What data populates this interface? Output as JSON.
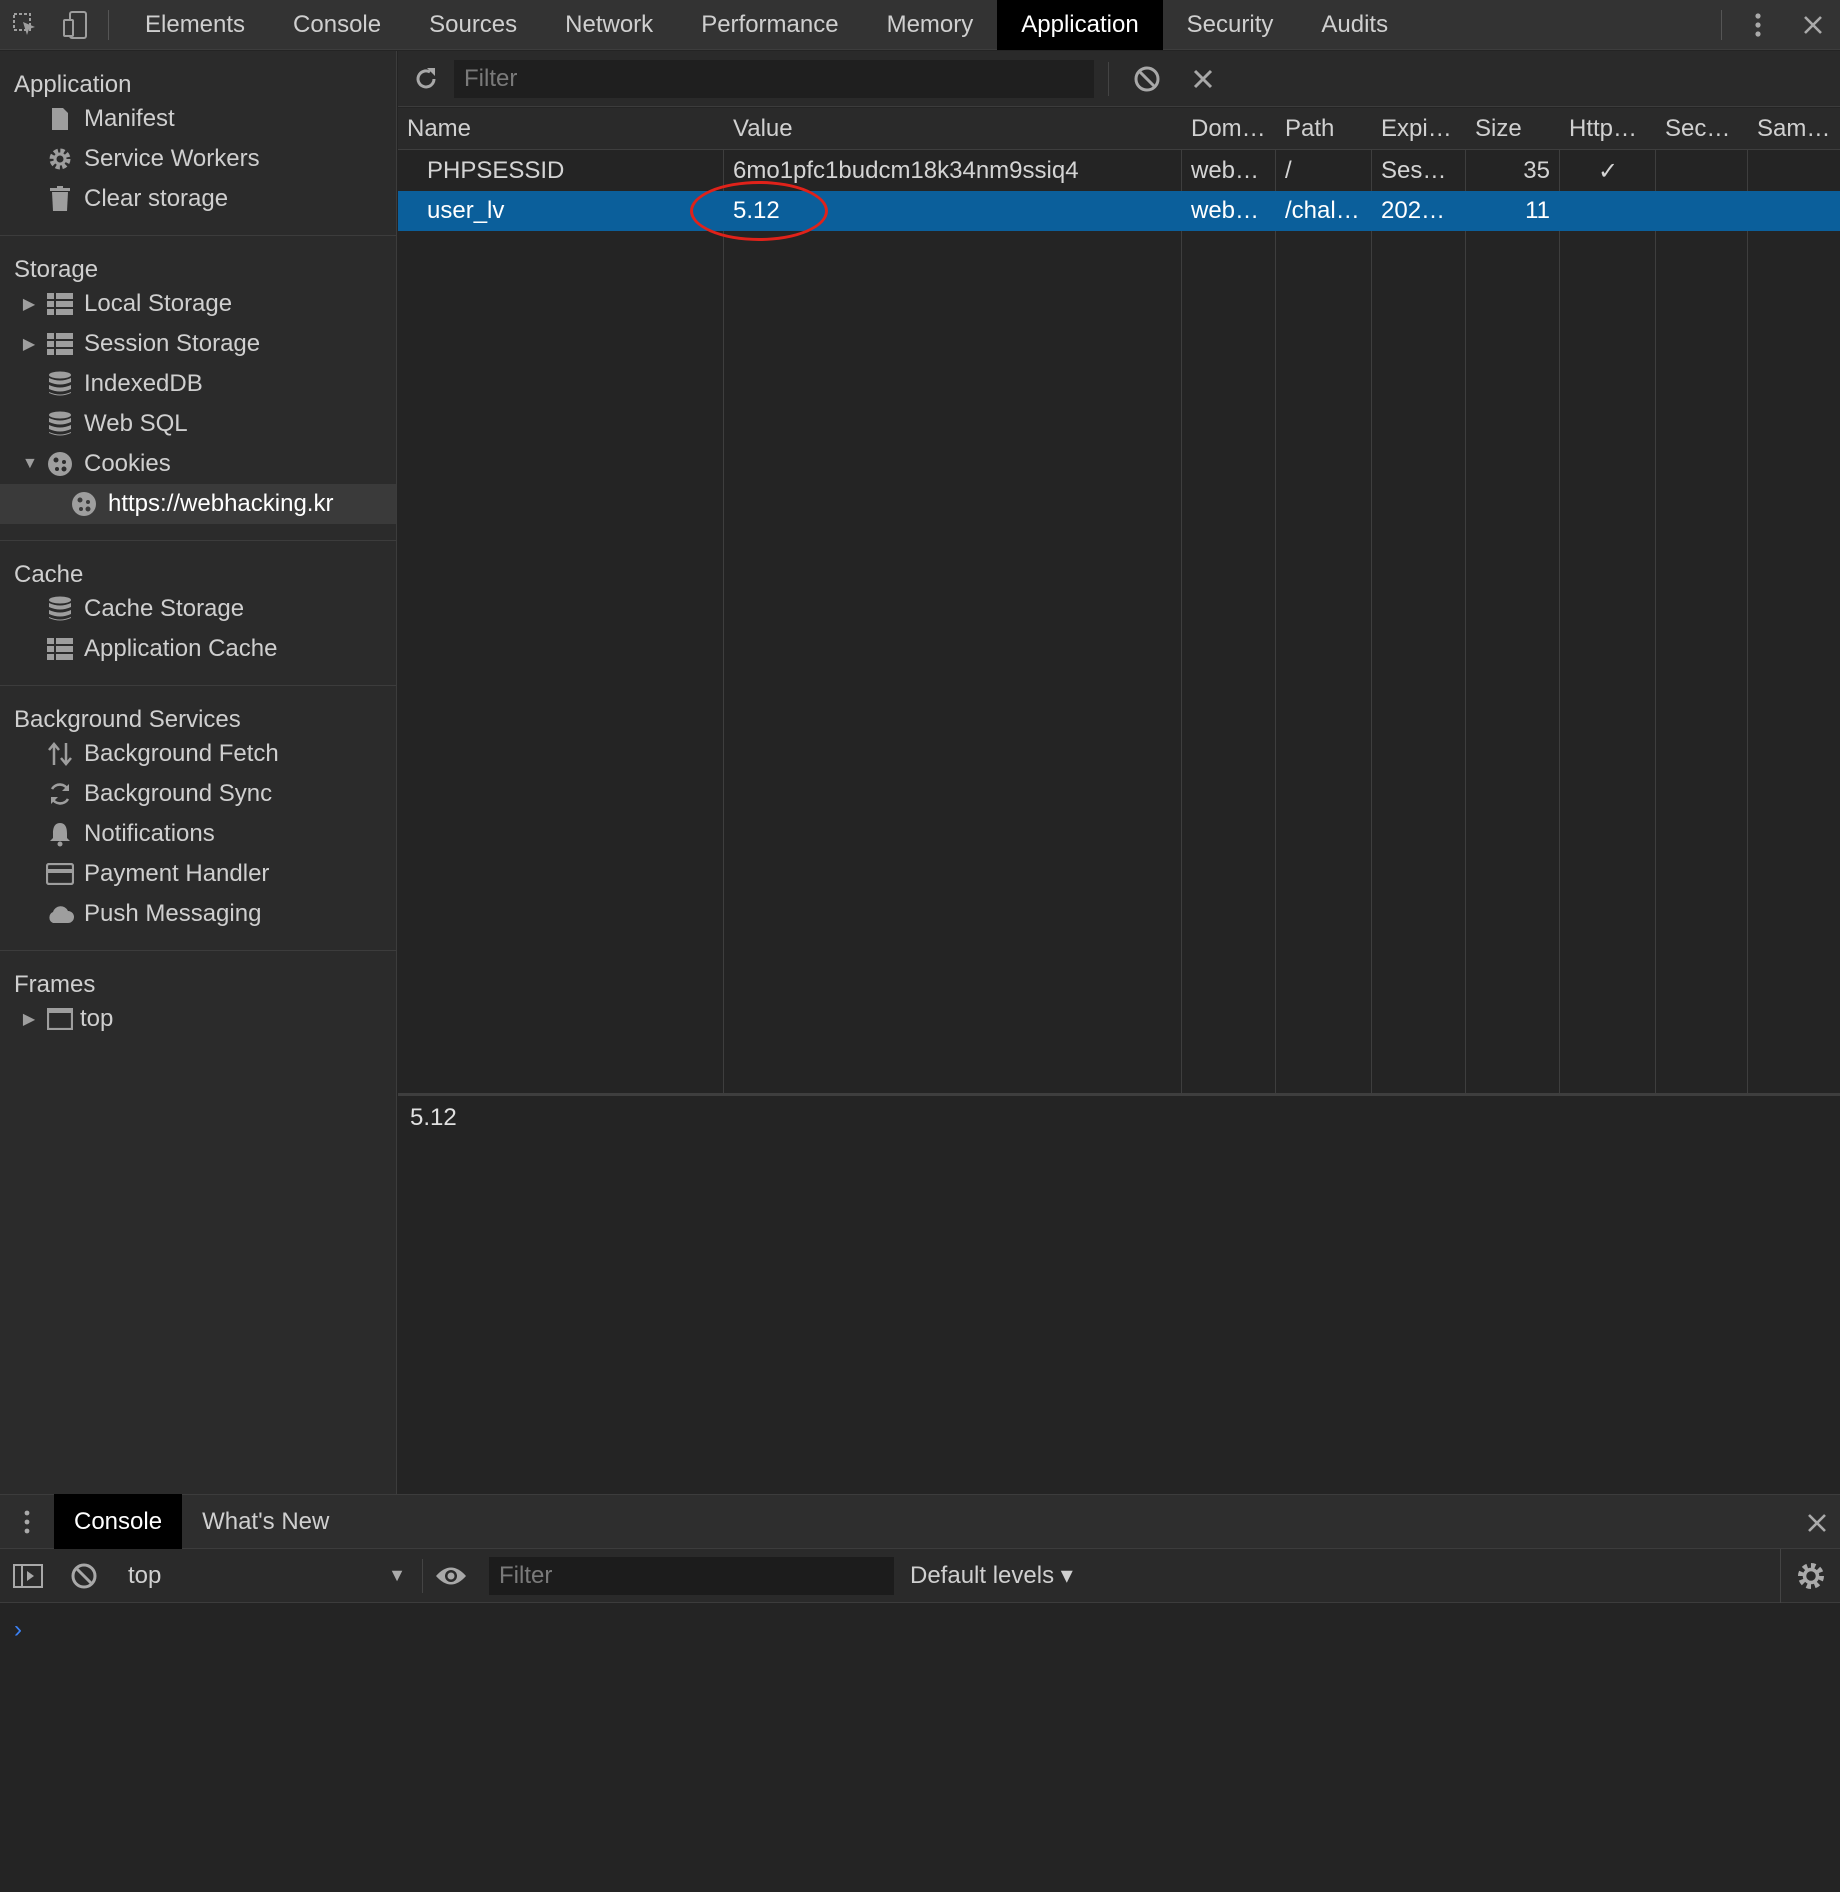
{
  "devtools_tabs": [
    "Elements",
    "Console",
    "Sources",
    "Network",
    "Performance",
    "Memory",
    "Application",
    "Security",
    "Audits"
  ],
  "active_tab": "Application",
  "sidebar": {
    "application_header": "Application",
    "application_items": [
      {
        "label": "Manifest",
        "icon": "document-icon"
      },
      {
        "label": "Service Workers",
        "icon": "gear-icon"
      },
      {
        "label": "Clear storage",
        "icon": "trash-icon"
      }
    ],
    "storage_header": "Storage",
    "storage_items": [
      {
        "label": "Local Storage",
        "icon": "grid-icon"
      },
      {
        "label": "Session Storage",
        "icon": "grid-icon"
      },
      {
        "label": "IndexedDB",
        "icon": "database-icon"
      },
      {
        "label": "Web SQL",
        "icon": "database-icon"
      },
      {
        "label": "Cookies",
        "icon": "cookie-icon"
      },
      {
        "label": "https://webhacking.kr",
        "icon": "cookie-icon"
      }
    ],
    "cache_header": "Cache",
    "cache_items": [
      {
        "label": "Cache Storage",
        "icon": "database-icon"
      },
      {
        "label": "Application Cache",
        "icon": "grid-icon"
      }
    ],
    "bg_header": "Background Services",
    "bg_items": [
      {
        "label": "Background Fetch",
        "icon": "arrows-updown-icon"
      },
      {
        "label": "Background Sync",
        "icon": "sync-icon"
      },
      {
        "label": "Notifications",
        "icon": "bell-icon"
      },
      {
        "label": "Payment Handler",
        "icon": "card-icon"
      },
      {
        "label": "Push Messaging",
        "icon": "cloud-icon"
      }
    ],
    "frames_header": "Frames",
    "frames_items": [
      {
        "label": "top",
        "icon": "frame-icon"
      }
    ]
  },
  "cookies": {
    "filter_placeholder": "Filter",
    "columns": [
      "Name",
      "Value",
      "Dom…",
      "Path",
      "Expi…",
      "Size",
      "Http…",
      "Sec…",
      "Sam…"
    ],
    "rows": [
      {
        "name": "PHPSESSID",
        "value": "6mo1pfc1budcm18k34nm9ssiq4",
        "domain": "web…",
        "path": "/",
        "expires": "Ses…",
        "size": "35",
        "http": "✓",
        "secure": "",
        "samesite": ""
      },
      {
        "name": "user_lv",
        "value": "5.12",
        "domain": "web…",
        "path": "/chal…",
        "expires": "202…",
        "size": "11",
        "http": "",
        "secure": "",
        "samesite": ""
      }
    ],
    "selected_value_preview": "5.12"
  },
  "drawer": {
    "tabs": [
      "Console",
      "What's New"
    ],
    "active": "Console",
    "context": "top",
    "filter_placeholder": "Filter",
    "levels": "Default levels ▾",
    "prompt": "›"
  },
  "colors": {
    "selection": "#0b5f9b",
    "annotation": "#e0221a",
    "prompt": "#3b82f6"
  }
}
